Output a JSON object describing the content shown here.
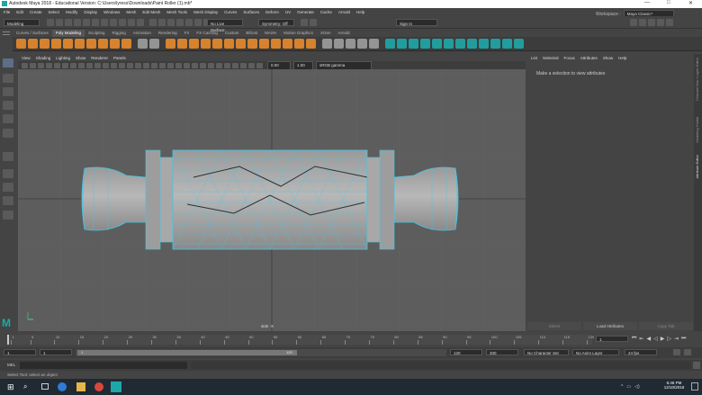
{
  "window": {
    "title": "Autodesk Maya 2018 - Educational Version: C:\\Users\\lyress\\Downloads\\Paint Roller (1).mb*",
    "controls": [
      "—",
      "□",
      "✕"
    ]
  },
  "menubar": {
    "items": [
      "File",
      "Edit",
      "Create",
      "Select",
      "Modify",
      "Display",
      "Windows",
      "Mesh",
      "Edit Mesh",
      "Mesh Tools",
      "Mesh Display",
      "Curves",
      "Surfaces",
      "Deform",
      "UV",
      "Generate",
      "Cache",
      "Arnold",
      "Help"
    ],
    "workspace_label": "Workspace :",
    "workspace_value": "Maya Classic*"
  },
  "statusline": {
    "mode": "Modeling",
    "live_surface": "No Live Surface",
    "symmetry": "Symmetry: Off",
    "sign_in": "Sign In"
  },
  "shelf_tabs": [
    "Curves / Surfaces",
    "Poly Modeling",
    "Sculpting",
    "Rigging",
    "Animation",
    "Rendering",
    "FX",
    "FX Caching",
    "Custom",
    "Bifrost",
    "MASH",
    "Motion Graphics",
    "XGen",
    "Arnold"
  ],
  "active_shelf_tab": "Poly Modeling",
  "panel": {
    "menu": [
      "View",
      "Shading",
      "Lighting",
      "Show",
      "Renderer",
      "Panels"
    ],
    "near_value": "0.00",
    "far_value": "1.00",
    "color_space": "sRGB gamma",
    "camera_label": "side -X"
  },
  "attribute_editor": {
    "menu": [
      "List",
      "Selected",
      "Focus",
      "Attributes",
      "Show",
      "Help"
    ],
    "message": "Make a selection to view attributes",
    "buttons": [
      "Select",
      "Load Attributes",
      "Copy Tab"
    ]
  },
  "side_tabs": [
    "Channel Box / Layer Editor",
    "Modeling Toolkit",
    "Attribute Editor"
  ],
  "timeline": {
    "ticks": [
      "1",
      "5",
      "10",
      "15",
      "20",
      "25",
      "30",
      "35",
      "40",
      "45",
      "50",
      "55",
      "60",
      "65",
      "70",
      "75",
      "80",
      "85",
      "90",
      "95",
      "100",
      "105",
      "110",
      "115",
      "120"
    ],
    "current_frame": "1"
  },
  "range": {
    "start": "1",
    "start_inner": "1",
    "slider_value": "1",
    "slider_end": "120",
    "end_inner": "120",
    "end": "200",
    "character_set": "No Character Set",
    "anim_layer": "No Anim Layer",
    "fps": "24 fps"
  },
  "cmdline": {
    "lang": "MEL"
  },
  "helpline": {
    "text": "Select Tool: select an object"
  },
  "taskbar": {
    "time": "6:46 PM",
    "date": "12/10/2018"
  },
  "colors": {
    "accent_orange": "#e8892b",
    "wire_cyan": "#3ec8e8",
    "maya_teal": "#1ea7a8"
  }
}
